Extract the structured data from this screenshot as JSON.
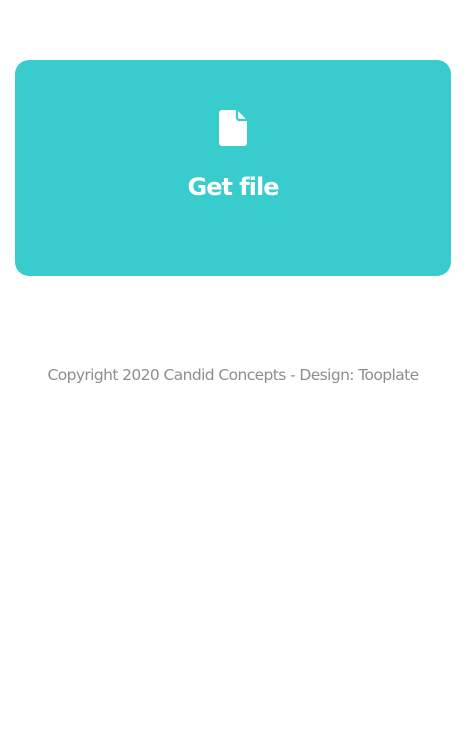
{
  "card": {
    "icon": "file-icon",
    "label": "Get file",
    "background_color": "#39cccc",
    "text_color": "#ffffff"
  },
  "footer": {
    "text": "Copyright 2020 Candid Concepts - Design: Tooplate",
    "text_color": "#8e8e8e"
  }
}
